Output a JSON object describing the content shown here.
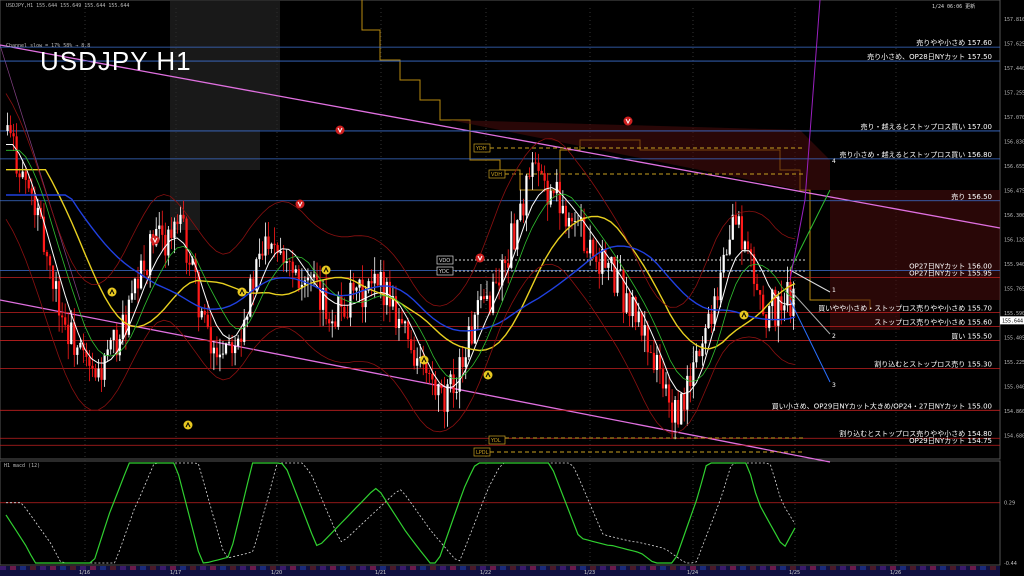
{
  "header": {
    "symbol_info": "USDJPY,H1  155.644 155.649 155.644 155.644",
    "channel_info": "Channel slow = 17% 58% → 8.8",
    "updated": "1/24 06:06 更新",
    "title": "USDJPY H1"
  },
  "macd_panel": {
    "label": "H1  macd (12)",
    "ticks": [
      "0.29",
      "-0.44"
    ]
  },
  "price_axis": [
    "157.810",
    "157.625",
    "157.440",
    "157.255",
    "157.070",
    "156.830",
    "156.655",
    "156.475",
    "156.300",
    "156.120",
    "155.940",
    "155.765",
    "155.590",
    "155.405",
    "155.225",
    "155.040",
    "154.860",
    "154.680"
  ],
  "time_axis": [
    "1/16",
    "1/17",
    "1/20",
    "1/21",
    "1/22",
    "1/23",
    "1/24",
    "1/25",
    "1/26"
  ],
  "levels": [
    {
      "label": "売りやや小さめ 157.60",
      "price": 157.6,
      "color": "#3d6fd0"
    },
    {
      "label": "売り小さめ、OP28日NYカット 157.50",
      "price": 157.5,
      "color": "#3d6fd0"
    },
    {
      "label": "売り・越えるとストップロス買い 157.00",
      "price": 157.0,
      "color": "#3d6fd0"
    },
    {
      "label": "売り小さめ・越えるとストップロス買い 156.80",
      "price": 156.8,
      "color": "#3d6fd0"
    },
    {
      "label": "売り 156.50",
      "price": 156.5,
      "color": "#3d6fd0"
    },
    {
      "label": "OP27日NYカット 156.00",
      "price": 156.0,
      "color": "#3d6fd0"
    },
    {
      "label": "OP27日NYカット 155.95",
      "price": 155.95,
      "color": "#c02020"
    },
    {
      "label": "買いやや小さめ・ストップロス売りやや小さめ 155.70",
      "price": 155.7,
      "color": "#c02020"
    },
    {
      "label": "ストップロス売りやや小さめ 155.60",
      "price": 155.6,
      "color": "#c02020"
    },
    {
      "label": "買い 155.50",
      "price": 155.5,
      "color": "#c02020"
    },
    {
      "label": "割り込むとストップロス売り 155.30",
      "price": 155.3,
      "color": "#c02020"
    },
    {
      "label": "買い小さめ、OP29日NYカット大きめ/OP24・27日NYカット 155.00",
      "price": 155.0,
      "color": "#c02020"
    },
    {
      "label": "割り込むとストップロス売りやや小さめ 154.80",
      "price": 154.8,
      "color": "#c02020"
    },
    {
      "label": "OP29日NYカット 154.75",
      "price": 154.75,
      "color": "#c02020"
    }
  ],
  "markers": {
    "ydh": "YDH",
    "vdh": "VDH",
    "vdo": "VDO",
    "ydc": "YDC",
    "ydl": "YDL",
    "lpdl": "LPDL",
    "scenarios": [
      "1",
      "2",
      "3",
      "4"
    ],
    "current_price": "155.644"
  },
  "chart_data": {
    "type": "candlestick",
    "title": "USDJPY H1",
    "ylim": [
      154.68,
      157.88
    ],
    "x": [
      "1/16",
      "1/17",
      "1/20",
      "1/21",
      "1/22",
      "1/23",
      "1/24",
      "1/25"
    ],
    "close_path_approx": [
      157.0,
      156.4,
      155.6,
      155.2,
      155.6,
      156.2,
      156.3,
      155.4,
      155.6,
      156.3,
      156.0,
      155.7,
      155.8,
      155.9,
      155.4,
      155.0,
      155.6,
      156.0,
      156.7,
      156.5,
      156.2,
      155.9,
      155.5,
      154.9,
      155.6,
      156.4,
      155.7,
      155.8
    ],
    "macd_ylim": [
      -0.44,
      0.29
    ],
    "grid": true
  }
}
